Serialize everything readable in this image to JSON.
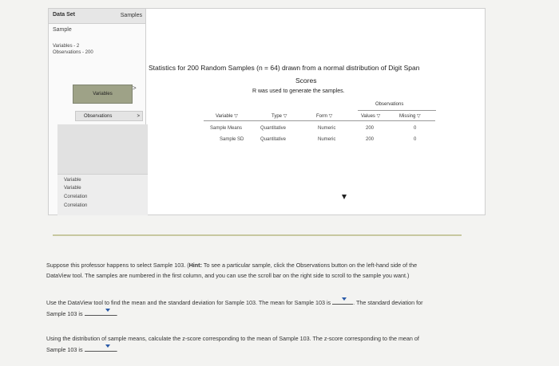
{
  "sidebar": {
    "header_left": "Data Set",
    "header_right": "Samples",
    "sample_label": "Sample",
    "variables_line": "Variables - 2",
    "observations_line": "Observations - 200",
    "variables_button": "Variables",
    "observations_button": "Observations",
    "variable_list": [
      "Variable",
      "Variable",
      "Correlation",
      "Correlation"
    ]
  },
  "main": {
    "title_line1": "Statistics for 200 Random Samples (n = 64) drawn from a normal distribution of Digit Span",
    "title_line2": "Scores",
    "subtitle": "R was used to generate the samples.",
    "observations_group": "Observations",
    "columns": [
      "Variable",
      "Type",
      "Form",
      "Values",
      "Missing"
    ],
    "rows": [
      {
        "variable": "Sample Means",
        "type": "Quantitative",
        "form": "Numeric",
        "values": "200",
        "missing": "0"
      },
      {
        "variable": "Sample SD",
        "type": "Quantitative",
        "form": "Numeric",
        "values": "200",
        "missing": "0"
      }
    ]
  },
  "questions": {
    "p1_a": "Suppose this professor happens to select Sample 103. (",
    "p1_hint": "Hint:",
    "p1_b": " To see a particular sample, click the Observations button on the left-hand side of the",
    "p1_c": "DataView tool. The samples are numbered in the first column, and you can use the scroll bar on the right side to scroll to the sample you want.)",
    "p2_a": "Use the DataView tool to find the mean and the standard deviation for Sample 103. The mean for Sample 103 is",
    "p2_b": ". The standard deviation for",
    "p2_c": "Sample 103 is",
    "p3_a": "Using the distribution of sample means, calculate the z-score corresponding to the mean of Sample 103. The z-score corresponding to the mean of",
    "p3_b": "Sample 103 is"
  }
}
